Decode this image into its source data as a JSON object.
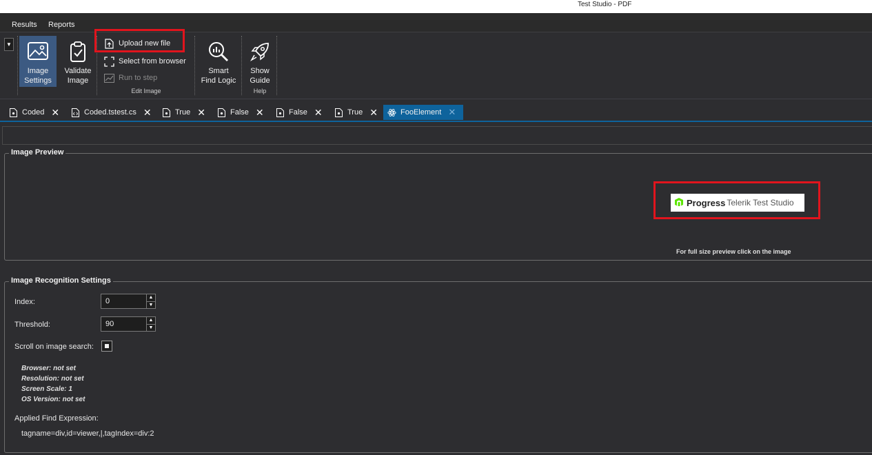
{
  "window": {
    "title": "Test Studio - PDF"
  },
  "menu": [
    {
      "label": "Results"
    },
    {
      "label": "Reports"
    }
  ],
  "ribbon": {
    "dropdown_glyph": "▼",
    "image_settings": {
      "line1": "Image",
      "line2": "Settings",
      "icon": "image-icon"
    },
    "validate_image": {
      "line1": "Validate",
      "line2": "Image",
      "icon": "clipboard-check-icon"
    },
    "upload_new_file": {
      "label": "Upload new file",
      "icon": "file-upload-icon"
    },
    "select_from_browser": {
      "label": "Select from browser",
      "icon": "select-region-icon"
    },
    "run_to_step": {
      "label": "Run to step",
      "icon": "chart-line-icon"
    },
    "edit_image_group": "Edit Image",
    "smart_find_logic": {
      "line1": "Smart",
      "line2": "Find Logic",
      "icon": "magnifier-chart-icon"
    },
    "show_guide": {
      "line1": "Show",
      "line2": "Guide",
      "icon": "rocket-icon"
    },
    "help_group": "Help"
  },
  "tabs": [
    {
      "label": "Coded",
      "icon": "file-icon",
      "active": false
    },
    {
      "label": "Coded.tstest.cs",
      "icon": "code-file-icon",
      "active": false
    },
    {
      "label": "True",
      "icon": "file-icon",
      "active": false
    },
    {
      "label": "False",
      "icon": "file-icon",
      "active": false
    },
    {
      "label": "False",
      "icon": "file-icon",
      "active": false
    },
    {
      "label": "True",
      "icon": "file-icon",
      "active": false
    },
    {
      "label": "FooElement",
      "icon": "atom-icon",
      "active": true
    }
  ],
  "close_glyph": "✕",
  "image_preview": {
    "legend": "Image Preview",
    "brand_name": "Progress",
    "brand_rest": "Telerik Test Studio",
    "hint": "For full size preview click on the image"
  },
  "recognition": {
    "legend": "Image Recognition Settings",
    "index_label": "Index:",
    "index_value": "0",
    "threshold_label": "Threshold:",
    "threshold_value": "90",
    "scroll_label": "Scroll on image search:",
    "browser": "Browser: not set",
    "resolution": "Resolution: not set",
    "screen_scale": "Screen Scale: 1",
    "os_version": "OS Version: not set",
    "find_expression_label": "Applied Find Expression:",
    "find_expression": "tagname=div,id=viewer,|,tagIndex=div:2"
  },
  "colors": {
    "highlight": "#e1141d",
    "active_tab": "#0e639c",
    "active_button": "#3c5a82",
    "progress_green": "#5ce500"
  }
}
